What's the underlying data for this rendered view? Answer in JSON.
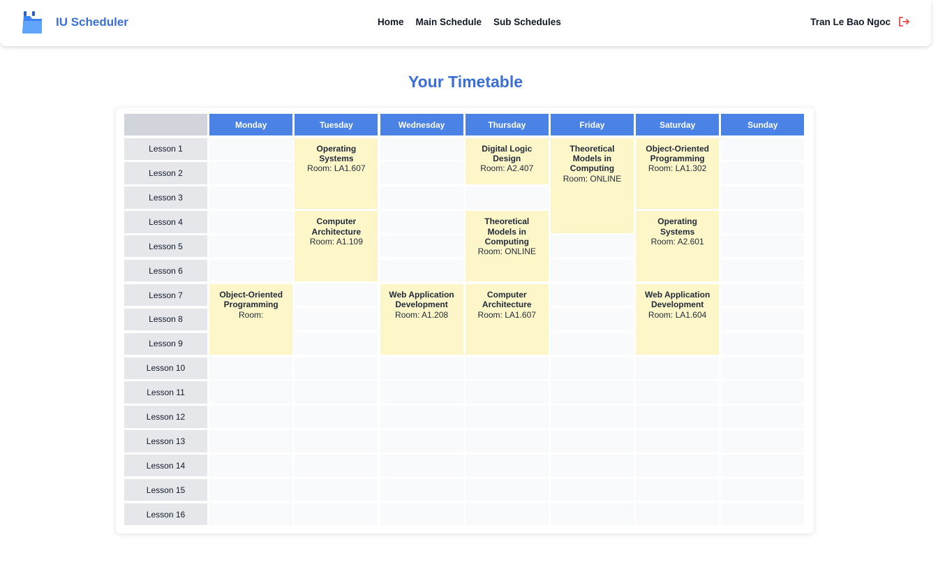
{
  "app": {
    "name": "IU Scheduler",
    "brand_icon": "folder-calendar-icon",
    "accent": "#3b6ed8"
  },
  "nav": {
    "home": "Home",
    "main_schedule": "Main Schedule",
    "sub_schedules": "Sub Schedules"
  },
  "user": {
    "name": "Tran Le Bao Ngoc",
    "logout_icon": "logout-icon",
    "logout_color": "#ef4444"
  },
  "page": {
    "title": "Your Timetable"
  },
  "timetable": {
    "days": [
      "Monday",
      "Tuesday",
      "Wednesday",
      "Thursday",
      "Friday",
      "Saturday",
      "Sunday"
    ],
    "lessons": [
      "Lesson 1",
      "Lesson 2",
      "Lesson 3",
      "Lesson 4",
      "Lesson 5",
      "Lesson 6",
      "Lesson 7",
      "Lesson 8",
      "Lesson 9",
      "Lesson 10",
      "Lesson 11",
      "Lesson 12",
      "Lesson 13",
      "Lesson 14",
      "Lesson 15",
      "Lesson 16"
    ],
    "header_color": "#4a82e6",
    "course_color": "#fdf6c9",
    "courses": [
      {
        "day": 2,
        "start": 1,
        "span": 3,
        "name": "Operating Systems",
        "room": "Room: LA1.607"
      },
      {
        "day": 2,
        "start": 4,
        "span": 3,
        "name": "Computer Architecture",
        "room": "Room: A1.109"
      },
      {
        "day": 4,
        "start": 1,
        "span": 2,
        "name": "Digital Logic Design",
        "room": "Room: A2.407"
      },
      {
        "day": 4,
        "start": 4,
        "span": 3,
        "name": "Theoretical Models in Computing",
        "room": "Room: ONLINE"
      },
      {
        "day": 4,
        "start": 7,
        "span": 3,
        "name": "Computer Architecture",
        "room": "Room: LA1.607"
      },
      {
        "day": 5,
        "start": 1,
        "span": 4,
        "name": "Theoretical Models in Computing",
        "room": "Room: ONLINE"
      },
      {
        "day": 6,
        "start": 1,
        "span": 3,
        "name": "Object-Oriented Programming",
        "room": "Room: LA1.302"
      },
      {
        "day": 6,
        "start": 4,
        "span": 3,
        "name": "Operating Systems",
        "room": "Room: A2.601"
      },
      {
        "day": 6,
        "start": 7,
        "span": 3,
        "name": "Web Application Development",
        "room": "Room: LA1.604"
      },
      {
        "day": 1,
        "start": 7,
        "span": 3,
        "name": "Object-Oriented Programming",
        "room": "Room:"
      },
      {
        "day": 3,
        "start": 7,
        "span": 3,
        "name": "Web Application Development",
        "room": "Room: A1.208"
      }
    ]
  }
}
